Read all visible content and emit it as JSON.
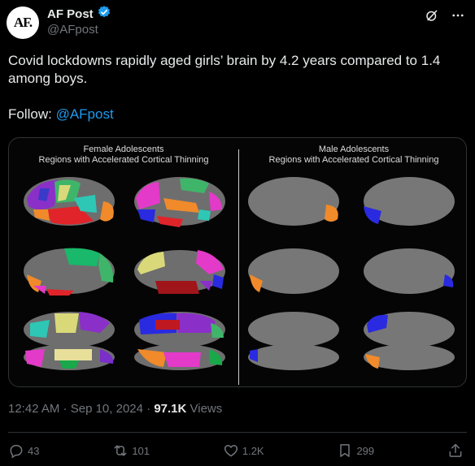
{
  "author": {
    "avatar_text": "AF.",
    "display_name": "AF Post",
    "handle": "@AFpost",
    "verified": true
  },
  "header_icons": [
    "grok-icon",
    "more-icon"
  ],
  "tweet": {
    "text_line1": "Covid lockdowns rapidly aged girls’ brain by 4.2 years compared to 1.4",
    "text_line2": "among boys.",
    "follow_label": "Follow: ",
    "follow_mention": "@AFpost"
  },
  "media": {
    "female_title_line1": "Female Adolescents",
    "female_title_line2": "Regions with Accelerated Cortical Thinning",
    "male_title_line1": "Male Adolescents",
    "male_title_line2": "Regions with Accelerated Cortical Thinning"
  },
  "meta": {
    "time": "12:42 AM",
    "date": "Sep 10, 2024",
    "separator": " · ",
    "views_count": "97.1K",
    "views_label": " Views"
  },
  "actions": {
    "replies": "43",
    "reposts": "101",
    "likes": "1.2K",
    "bookmarks": "299"
  },
  "colors": {
    "background": "#000000",
    "text": "#e7e9ea",
    "muted": "#71767b",
    "link": "#1d9bf0",
    "border": "#2f3336"
  }
}
